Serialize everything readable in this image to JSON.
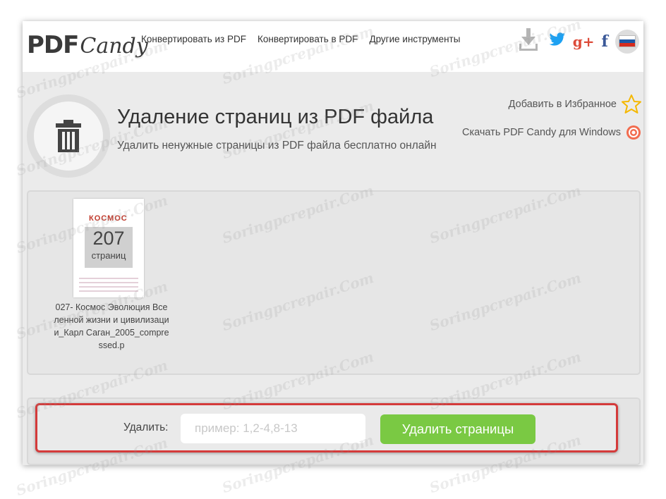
{
  "header": {
    "logo_pdf": "PDF",
    "logo_candy": "Candy",
    "nav": [
      "Конвертировать из PDF",
      "Конвертировать в PDF",
      "Другие инструменты"
    ],
    "icons": [
      "download-icon",
      "twitter-icon",
      "google-plus-icon",
      "facebook-icon",
      "russian-flag-icon"
    ]
  },
  "tool": {
    "title": "Удаление страниц из PDF файла",
    "subtitle": "Удалить ненужные страницы из PDF файла бесплатно онлайн",
    "icon": "trash-icon"
  },
  "side_links": {
    "favorite": "Добавить в Избранное",
    "download_windows": "Скачать PDF Candy для Windows"
  },
  "file": {
    "thumb_title": "КОСМОС",
    "page_count": "207",
    "page_label": "страниц",
    "name": "027- Космос Эволюция Вселенной жизни и цивилизации_Карл Саган_2005_compressed.p"
  },
  "delete": {
    "label": "Удалить:",
    "placeholder": "пример: 1,2-4,8-13",
    "value": "",
    "button": "Удалить страницы"
  },
  "watermark": "Soringpcrepair.Com",
  "colors": {
    "accent_green": "#7ac943",
    "highlight_red": "#d43a3a",
    "twitter": "#1da1f2",
    "google_plus": "#dd4b39",
    "facebook": "#3b5998"
  }
}
